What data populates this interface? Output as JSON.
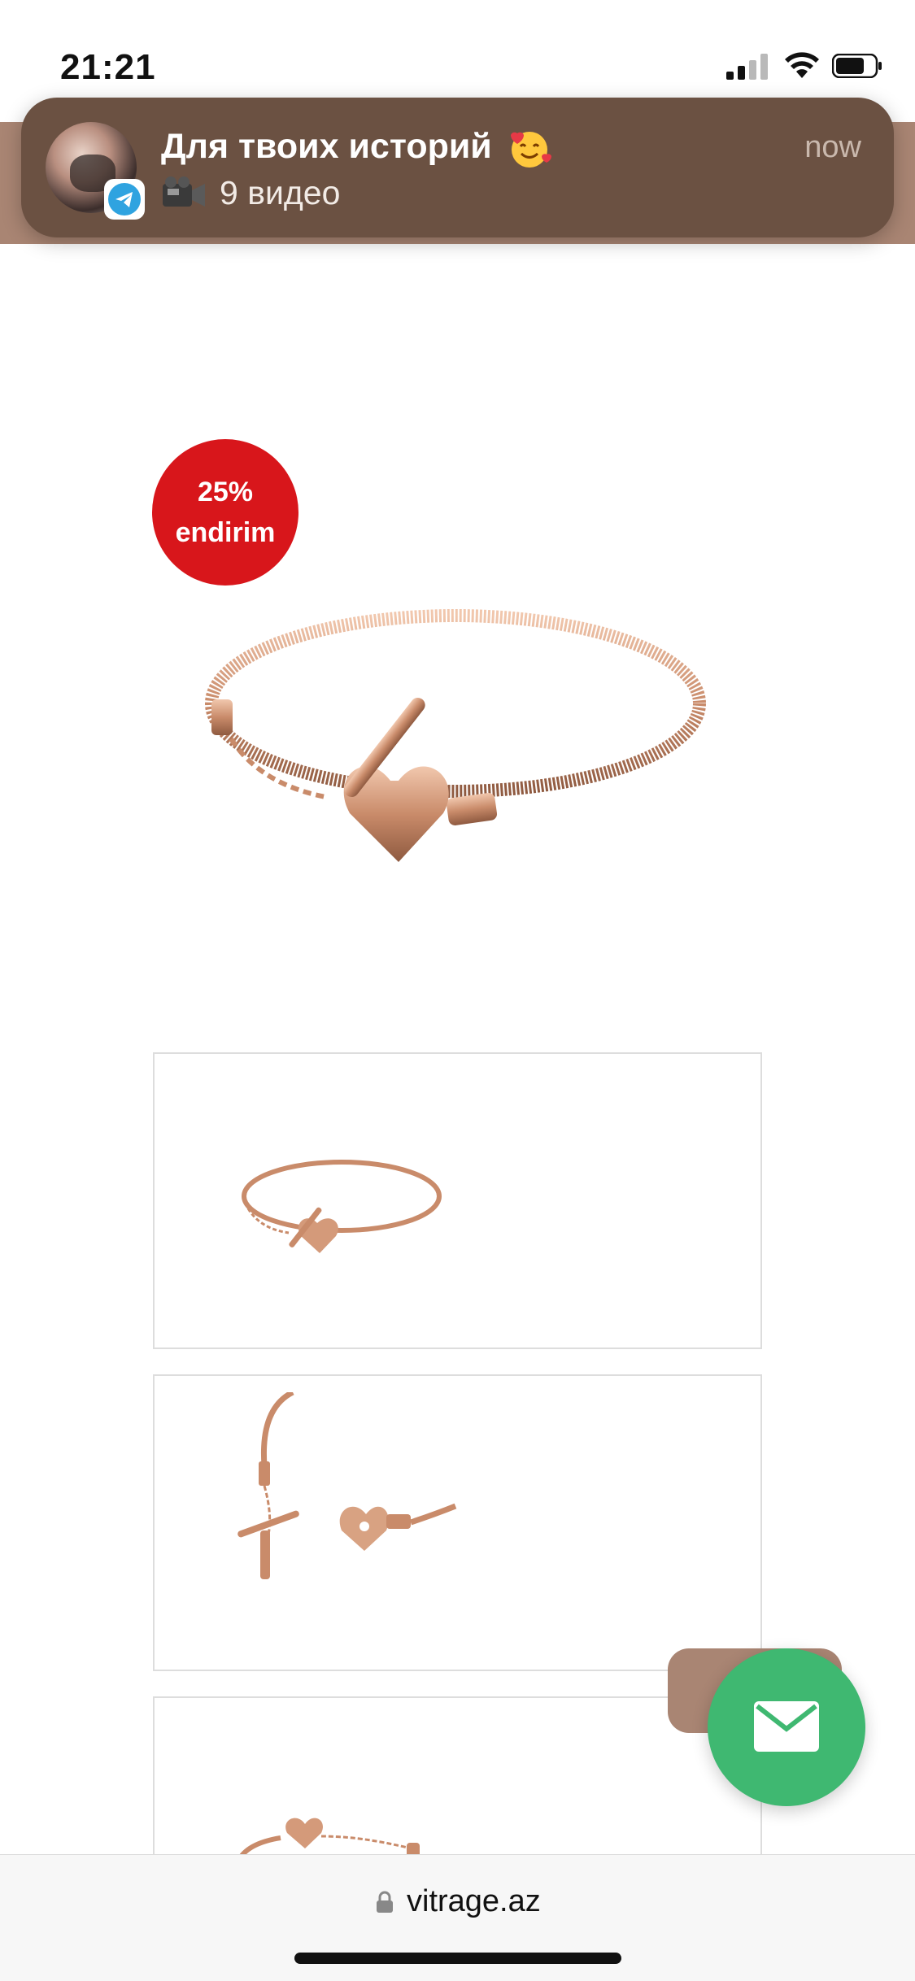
{
  "status_bar": {
    "time": "21:21",
    "icons": [
      "cellular-signal-icon",
      "wifi-icon",
      "battery-icon"
    ]
  },
  "notification": {
    "app_icon": "telegram-icon",
    "title": "Для твоих историй",
    "title_emoji": "smiling-face-with-hearts-emoji",
    "body_icon": "video-camera-icon",
    "body": "9 видео",
    "time": "now",
    "background": "#6b5142"
  },
  "product": {
    "discount_percent": "25%",
    "discount_label": "endirim",
    "discount_color": "#d8161b",
    "main_image": "rose-gold-snake-chain-bracelet-heart-t-bar",
    "thumbnails": [
      "bracelet-full-view",
      "bracelet-clasp-detail",
      "bracelet-side-view"
    ]
  },
  "floating": {
    "mail_icon": "envelope-icon",
    "mail_color": "#3fb871",
    "accent_color": "#a98573"
  },
  "browser": {
    "url": "vitrage.az",
    "lock_icon": "lock-icon"
  }
}
